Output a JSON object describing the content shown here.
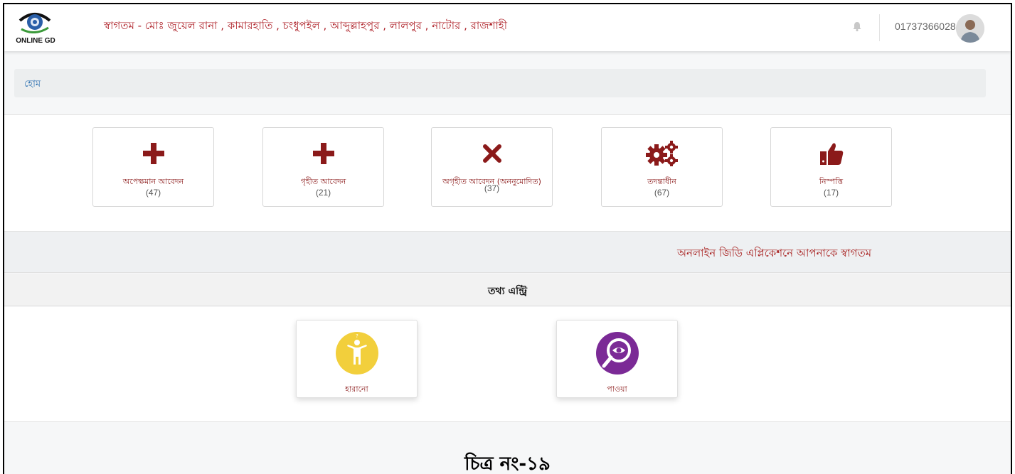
{
  "header": {
    "logo_text": "ONLINE GD",
    "welcome": "স্বাগতম - মোঃ জুয়েল রানা , কামারহাতি , চংধুপইল , আব্দুল্লাহপুর , লালপুর , নাটোর , রাজশাহী",
    "phone": "01737366028",
    "bell_icon": "bell-icon",
    "avatar": "user-avatar"
  },
  "breadcrumb": {
    "home": "হোম"
  },
  "stats": [
    {
      "label": "অপেক্ষমান আবেদন",
      "count": "(47)",
      "icon": "plus-icon"
    },
    {
      "label": "গৃহীত আবেদন",
      "count": "(21)",
      "icon": "plus-icon"
    },
    {
      "label": "অগৃহীত আবেদন (অননুমোদিত)",
      "count": "(37)",
      "icon": "close-icon"
    },
    {
      "label": "তদন্তাধীন",
      "count": "(67)",
      "icon": "gears-icon"
    },
    {
      "label": "নিস্পত্তি",
      "count": "(17)",
      "icon": "thumbs-up-icon"
    }
  ],
  "welcome_band": "অনলাইন জিডি এপ্লিকেশনে আপনাকে স্বাগতম",
  "entry": {
    "heading": "তথ্য এন্ট্রি",
    "items": [
      {
        "label": "হারানো",
        "icon": "lost-person-icon"
      },
      {
        "label": "পাওয়া",
        "icon": "found-search-icon"
      }
    ]
  },
  "caption": "চিত্র নং-১৯",
  "colors": {
    "accent": "#8b1a1a",
    "welcome_red": "#b0262d",
    "lost_yellow": "#f2cf3c",
    "found_purple": "#7b2a96",
    "link_blue": "#2a6fb0"
  }
}
